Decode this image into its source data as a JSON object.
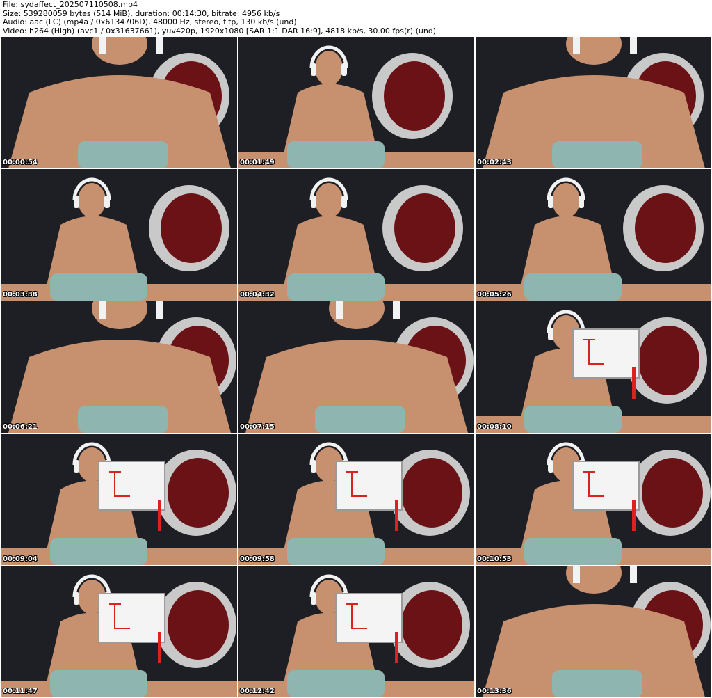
{
  "header": {
    "file_line": "File: sydaffect_202507110508.mp4",
    "size_line": "Size: 539280059 bytes (514 MiB), duration: 00:14:30, bitrate: 4956 kb/s",
    "audio_line": "Audio: aac (LC) (mp4a / 0x6134706D), 48000 Hz, stereo, fltp, 130 kb/s (und)",
    "video_line": "Video: h264 (High) (avc1 / 0x31637661), yuv420p, 1920x1080 [SAR 1:1 DAR 16:9], 4818 kb/s, 30.00 fps(r) (und)"
  },
  "thumbnails": [
    {
      "timestamp": "00:00:54"
    },
    {
      "timestamp": "00:01:49"
    },
    {
      "timestamp": "00:02:43"
    },
    {
      "timestamp": "00:03:38"
    },
    {
      "timestamp": "00:04:32"
    },
    {
      "timestamp": "00:05:26"
    },
    {
      "timestamp": "00:06:21"
    },
    {
      "timestamp": "00:07:15"
    },
    {
      "timestamp": "00:08:10"
    },
    {
      "timestamp": "00:09:04"
    },
    {
      "timestamp": "00:09:58"
    },
    {
      "timestamp": "00:10:53"
    },
    {
      "timestamp": "00:11:47"
    },
    {
      "timestamp": "00:12:42"
    },
    {
      "timestamp": "00:13:36"
    }
  ],
  "colors": {
    "background": "#1d1f24",
    "skin": "#c7906f",
    "shorts": "#8fb5b0",
    "chair_shell": "#c9c9c9",
    "chair_inner": "#6b1216",
    "headphones": "#f2f2f2",
    "whiteboard": "#f4f4f4",
    "marker_red": "#d9231f"
  }
}
